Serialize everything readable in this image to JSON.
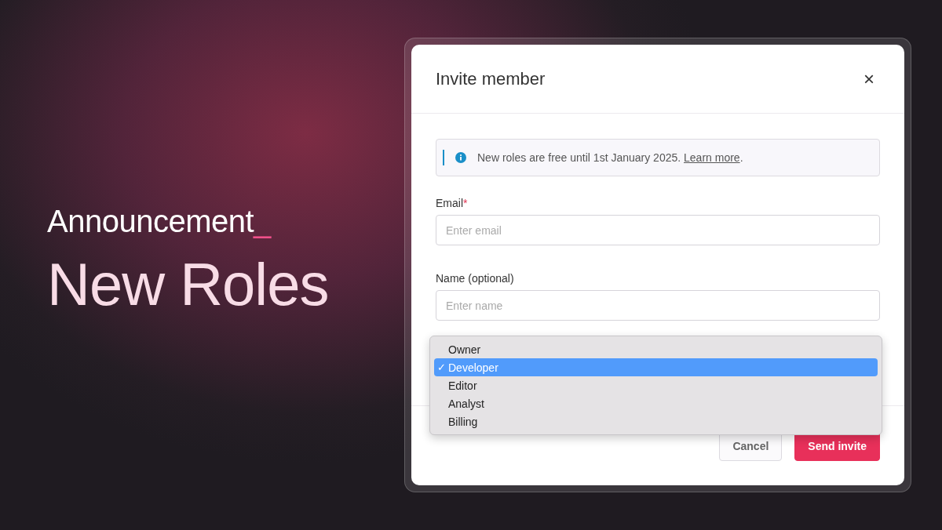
{
  "headline": {
    "label": "Announcement",
    "cursor": "_",
    "title": "New Roles"
  },
  "dialog": {
    "title": "Invite member",
    "close": "×",
    "notice": {
      "text": "New roles are free until 1st January 2025.",
      "link": "Learn more",
      "end": "."
    },
    "fields": [
      {
        "label": "Email",
        "required_mark": "*",
        "placeholder": "Enter email"
      },
      {
        "label": "Name (optional)",
        "placeholder": "Enter name"
      }
    ],
    "role_menu": [
      {
        "label": "Owner",
        "selected": false
      },
      {
        "label": "Developer",
        "selected": true
      },
      {
        "label": "Editor",
        "selected": false
      },
      {
        "label": "Analyst",
        "selected": false
      },
      {
        "label": "Billing",
        "selected": false
      }
    ],
    "check": "✓",
    "buttons": [
      {
        "label": "Cancel",
        "kind": "secondary"
      },
      {
        "label": "Send invite",
        "kind": "primary"
      }
    ]
  }
}
